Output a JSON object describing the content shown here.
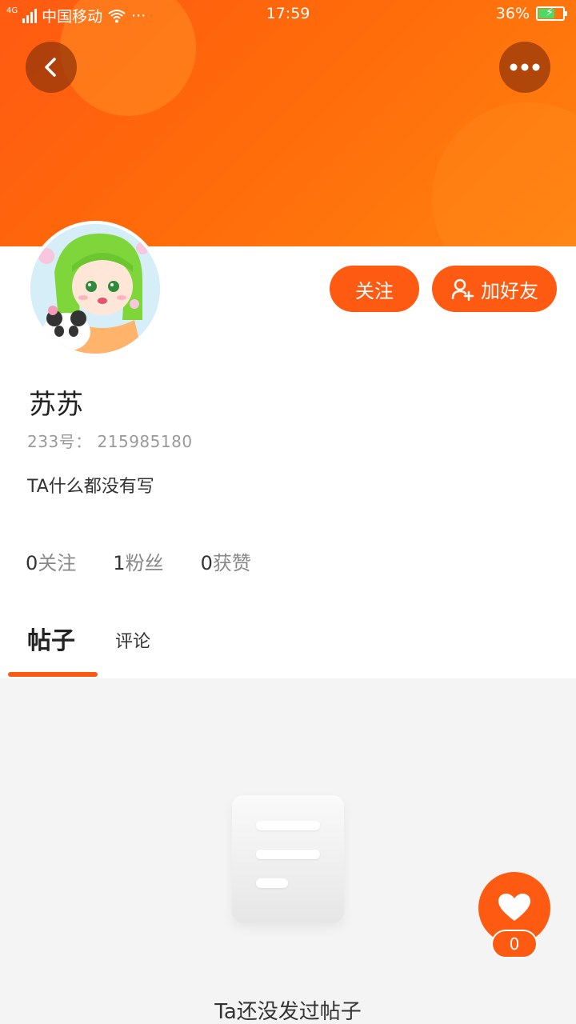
{
  "statusbar": {
    "network": "4G",
    "carrier": "中国移动",
    "extra": "···",
    "time": "17:59",
    "battery": "36%"
  },
  "header": {
    "back_icon": "chevron-left-icon",
    "more_icon": "more-horizontal-icon"
  },
  "profile": {
    "follow_label": "关注",
    "add_friend_label": "加好友",
    "name": "苏苏",
    "uid": "233号： 215985180",
    "bio": "TA什么都没有写",
    "stats": {
      "following_num": "0",
      "following_label": "关注",
      "fans_num": "1",
      "fans_label": "粉丝",
      "likes_num": "0",
      "likes_label": "获赞"
    }
  },
  "tabs": [
    {
      "label": "帖子",
      "active": true
    },
    {
      "label": "评论",
      "active": false
    }
  ],
  "empty": {
    "text": "Ta还没发过帖子"
  },
  "like": {
    "count": "0"
  },
  "colors": {
    "accent": "#ff5a12",
    "header_gradient_end": "#ff8210"
  }
}
